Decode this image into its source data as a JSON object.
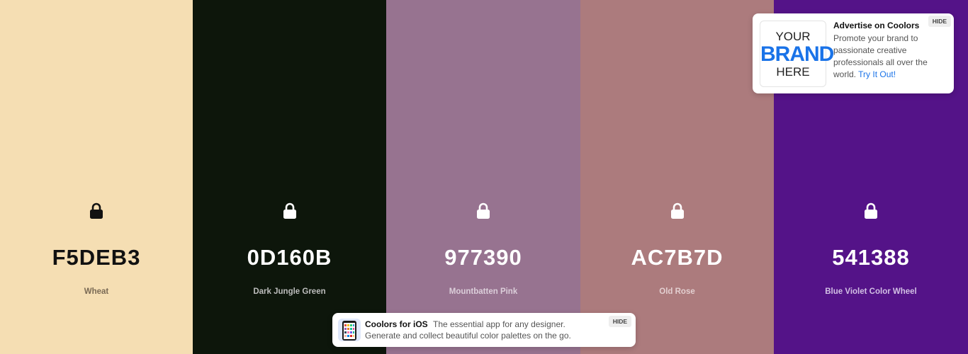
{
  "palette": {
    "colors": [
      {
        "hex": "F5DEB3",
        "name": "Wheat",
        "bg": "#F5DEB3",
        "fg": "#111111",
        "name_color": "#7a6a55"
      },
      {
        "hex": "0D160B",
        "name": "Dark Jungle Green",
        "bg": "#0D160B",
        "fg": "#ffffff",
        "name_color": "#bdbdbd"
      },
      {
        "hex": "977390",
        "name": "Mountbatten Pink",
        "bg": "#977390",
        "fg": "#ffffff",
        "name_color": "#dccfda"
      },
      {
        "hex": "AC7B7D",
        "name": "Old Rose",
        "bg": "#AC7B7D",
        "fg": "#ffffff",
        "name_color": "#e3cfd0"
      },
      {
        "hex": "541388",
        "name": "Blue Violet Color Wheel",
        "bg": "#541388",
        "fg": "#ffffff",
        "name_color": "#d2c0e4"
      }
    ],
    "lock_icon": "lock-icon"
  },
  "ad": {
    "image_text": [
      "YOUR",
      "BRAND",
      "HERE"
    ],
    "title": "Advertise on Coolors",
    "text": "Promote your brand to passionate creative professionals all over the world.",
    "link": "Try It Out!",
    "hide_label": "HIDE"
  },
  "promo": {
    "title": "Coolors for iOS",
    "subtitle": "The essential app for any designer.",
    "line2": "Generate and collect beautiful color palettes on the go.",
    "hide_label": "HIDE",
    "icon": "phone-app-icon"
  }
}
